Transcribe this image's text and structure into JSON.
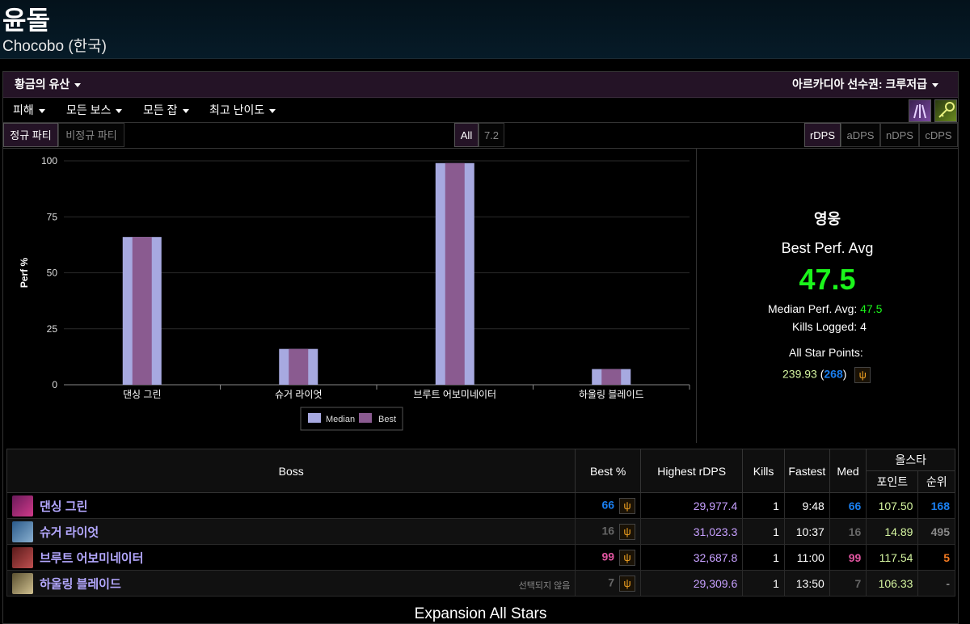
{
  "character": {
    "name": "윤돌",
    "server": "Chocobo (한국)"
  },
  "toolbar": {
    "zone": "황금의 유산",
    "ranking": "아르카디아 선수권: 크루저급",
    "metric": "피해",
    "boss": "모든 보스",
    "job": "모든 잡",
    "difficulty": "최고 난이도"
  },
  "tabs": {
    "party": [
      "정규 파티",
      "비정규 파티"
    ],
    "party_active": "정규 파티",
    "partition": [
      "All",
      "7.2"
    ],
    "partition_active": "All",
    "dps": [
      "rDPS",
      "aDPS",
      "nDPS",
      "cDPS"
    ],
    "dps_active": "rDPS"
  },
  "chart_data": {
    "type": "bar",
    "categories": [
      "댄싱 그린",
      "슈거 라이엇",
      "브루트 어보미네이터",
      "하울링 블레이드"
    ],
    "series": [
      {
        "name": "Median",
        "values": [
          66,
          16,
          99,
          7
        ],
        "color": "#a7a9e0"
      },
      {
        "name": "Best",
        "values": [
          66,
          16,
          99,
          7
        ],
        "color": "#8a5b90"
      }
    ],
    "ylabel": "Perf %",
    "yticks": [
      0,
      25,
      50,
      75,
      100
    ],
    "ylim": [
      0,
      100
    ],
    "legend": "bottom-center"
  },
  "stats": {
    "rank_title": "영웅",
    "best_label": "Best Perf. Avg",
    "best_value": "47.5",
    "median_label": "Median Perf. Avg:",
    "median_value": "47.5",
    "kills_label": "Kills Logged:",
    "kills_value": "4",
    "allstar_label": "All Star Points:",
    "allstar_points": "239.93",
    "allstar_rank": "268"
  },
  "table": {
    "headers": {
      "boss": "Boss",
      "best": "Best %",
      "highest": "Highest rDPS",
      "kills": "Kills",
      "fastest": "Fastest",
      "med": "Med",
      "allstar": "올스타",
      "points": "포인트",
      "rank": "순위"
    },
    "rows": [
      {
        "boss": "댄싱 그린",
        "note": "",
        "best": "66",
        "rdps": "29,977.4",
        "kills": "1",
        "fastest": "9:48",
        "med": "66",
        "points": "107.50",
        "rank": "168",
        "color": "#1a7ff0",
        "rank_color": "#1a7ff0",
        "thumb": "#c0308a"
      },
      {
        "boss": "슈거 라이엇",
        "note": "",
        "best": "16",
        "rdps": "31,023.3",
        "kills": "1",
        "fastest": "10:37",
        "med": "16",
        "points": "14.89",
        "rank": "495",
        "color": "#666666",
        "rank_color": "#888888",
        "thumb": "#4f8fb8"
      },
      {
        "boss": "브루트 어보미네이터",
        "note": "",
        "best": "99",
        "rdps": "32,687.8",
        "kills": "1",
        "fastest": "11:00",
        "med": "99",
        "points": "117.54",
        "rank": "5",
        "color": "#e055a0",
        "rank_color": "#f07820",
        "thumb": "#b04848"
      },
      {
        "boss": "하울링 블레이드",
        "note": "선택되지 않음",
        "best": "7",
        "rdps": "29,309.6",
        "kills": "1",
        "fastest": "13:50",
        "med": "7",
        "points": "106.33",
        "rank": "-",
        "color": "#666666",
        "rank_color": "#888888",
        "thumb": "#a89a70"
      }
    ]
  },
  "footer": {
    "title": "Expansion All Stars"
  }
}
